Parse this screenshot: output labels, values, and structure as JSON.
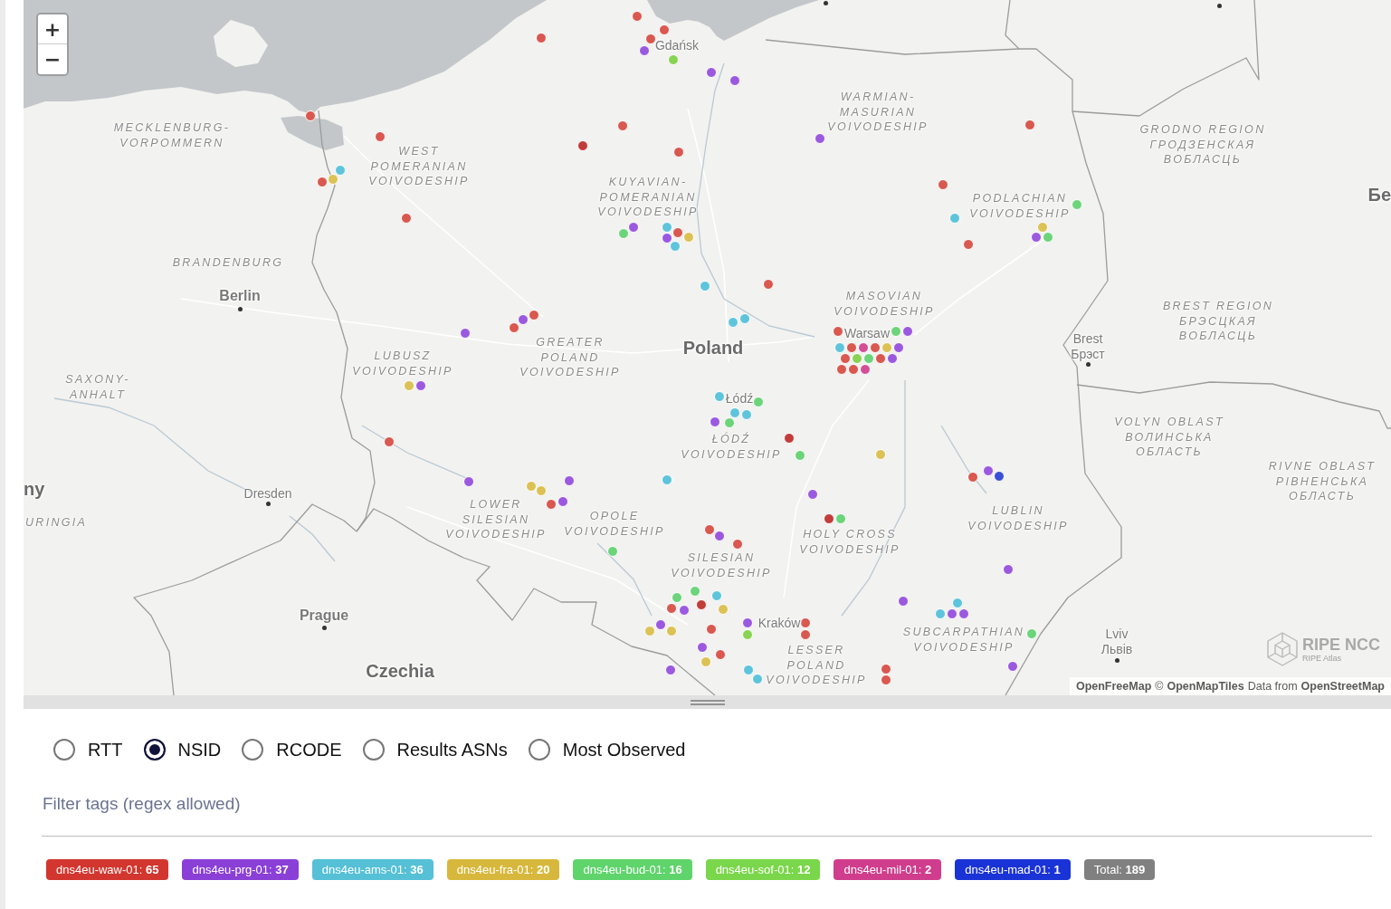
{
  "map": {
    "zoom": [
      {
        "kind": "in",
        "label": "+"
      },
      {
        "kind": "out",
        "label": "−"
      }
    ],
    "labels": [
      {
        "kind": "region",
        "lines": [
          "MECKLENBURG-",
          "VORPOMMERN"
        ]
      },
      {
        "kind": "town",
        "lines": [
          "Gdańsk"
        ]
      },
      {
        "kind": "region",
        "lines": [
          "WARMIAN-",
          "MASURIAN",
          "VOIVODESHIP"
        ]
      },
      {
        "kind": "region",
        "lines": [
          "WEST",
          "POMERANIAN",
          "VOIVODESHIP"
        ]
      },
      {
        "kind": "region",
        "lines": [
          "GRODNO REGION",
          "ГРОДЗЕНСКАЯ",
          "ВОБЛАСЦЬ"
        ]
      },
      {
        "kind": "region",
        "lines": [
          "KUYAVIAN-",
          "POMERANIAN",
          "VOIVODESHIP"
        ]
      },
      {
        "kind": "region",
        "lines": [
          "PODLACHIAN",
          "VOIVODESHIP"
        ]
      },
      {
        "kind": "country",
        "lines": [
          "Бе"
        ]
      },
      {
        "kind": "region",
        "lines": [
          "BRANDENBURG"
        ]
      },
      {
        "kind": "city",
        "lines": [
          "Berlin"
        ]
      },
      {
        "kind": "region",
        "lines": [
          "MASOVIAN",
          "VOIVODESHIP"
        ]
      },
      {
        "kind": "region",
        "lines": [
          "LUBUSZ",
          "VOIVODESHIP"
        ]
      },
      {
        "kind": "region",
        "lines": [
          "GREATER",
          "POLAND",
          "VOIVODESHIP"
        ]
      },
      {
        "kind": "country",
        "lines": [
          "Poland"
        ]
      },
      {
        "kind": "town",
        "lines": [
          "Warsaw"
        ]
      },
      {
        "kind": "town",
        "lines": [
          "Brest",
          "Брэст"
        ]
      },
      {
        "kind": "region",
        "lines": [
          "BREST REGION",
          "БРЭСЦКАЯ",
          "ВОБЛАСЦЬ"
        ]
      },
      {
        "kind": "region",
        "lines": [
          "SAXONY-",
          "ANHALT"
        ]
      },
      {
        "kind": "town",
        "lines": [
          "Łódź"
        ]
      },
      {
        "kind": "region",
        "lines": [
          "ŁÓDŹ",
          "VOIVODESHIP"
        ]
      },
      {
        "kind": "region",
        "lines": [
          "VOLYN OBLAST",
          "ВОЛИНСЬКА",
          "ОБЛАСТЬ"
        ]
      },
      {
        "kind": "country",
        "lines": [
          "ny"
        ]
      },
      {
        "kind": "town",
        "lines": [
          "Dresden"
        ]
      },
      {
        "kind": "region",
        "lines": [
          "RIVNE OBLAST",
          "РІВНЕНСЬКА",
          "ОБЛАСТЬ"
        ]
      },
      {
        "kind": "region",
        "lines": [
          "URINGIA"
        ]
      },
      {
        "kind": "region",
        "lines": [
          "LOWER",
          "SILESIAN",
          "VOIVODESHIP"
        ]
      },
      {
        "kind": "region",
        "lines": [
          "OPOLE",
          "VOIVODESHIP"
        ]
      },
      {
        "kind": "region",
        "lines": [
          "LUBLIN",
          "VOIVODESHIP"
        ]
      },
      {
        "kind": "region",
        "lines": [
          "HOLY CROSS",
          "VOIVODESHIP"
        ]
      },
      {
        "kind": "region",
        "lines": [
          "SILESIAN",
          "VOIVODESHIP"
        ]
      },
      {
        "kind": "city",
        "lines": [
          "Prague"
        ]
      },
      {
        "kind": "town",
        "lines": [
          "Kraków"
        ]
      },
      {
        "kind": "region",
        "lines": [
          "SUBCARPATHIAN",
          "VOIVODESHIP"
        ]
      },
      {
        "kind": "town",
        "lines": [
          "Lviv",
          "Львів"
        ]
      },
      {
        "kind": "country",
        "lines": [
          "Czechia"
        ]
      },
      {
        "kind": "region",
        "lines": [
          "LESSER",
          "POLAND",
          "VOIVODESHIP"
        ]
      }
    ],
    "markers": [
      {
        "color": "#d9584f"
      },
      {
        "color": "#d9584f"
      },
      {
        "color": "#d9584f"
      },
      {
        "color": "#d9584f"
      },
      {
        "color": "#9b59df"
      },
      {
        "color": "#88d455"
      },
      {
        "color": "#9b59df"
      },
      {
        "color": "#9b59df"
      },
      {
        "color": "#d9584f"
      },
      {
        "color": "#d9584f"
      },
      {
        "color": "#c23c3a"
      },
      {
        "color": "#d9584f"
      },
      {
        "color": "#d9584f"
      },
      {
        "color": "#9b59df"
      },
      {
        "color": "#d9584f"
      },
      {
        "color": "#5ec4db"
      },
      {
        "color": "#dcc154"
      },
      {
        "color": "#d9584f"
      },
      {
        "color": "#d9584f"
      },
      {
        "color": "#6cd47a"
      },
      {
        "color": "#5ec4db"
      },
      {
        "color": "#dcc154"
      },
      {
        "color": "#9b59df"
      },
      {
        "color": "#6cd47a"
      },
      {
        "color": "#d9584f"
      },
      {
        "color": "#d9584f"
      },
      {
        "color": "#9b59df"
      },
      {
        "color": "#6cd47a"
      },
      {
        "color": "#5ec4db"
      },
      {
        "color": "#5ec4db"
      },
      {
        "color": "#d9584f"
      },
      {
        "color": "#dcc154"
      },
      {
        "color": "#9b59df"
      },
      {
        "color": "#5ec4db"
      },
      {
        "color": "#d9584f"
      },
      {
        "color": "#5ec4db"
      },
      {
        "color": "#5ec4db"
      },
      {
        "color": "#d9584f"
      },
      {
        "color": "#9b59df"
      },
      {
        "color": "#d9584f"
      },
      {
        "color": "#9b59df"
      },
      {
        "color": "#9b59df"
      },
      {
        "color": "#d9584f"
      },
      {
        "color": "#9b59df"
      },
      {
        "color": "#6cd47a"
      },
      {
        "color": "#d9584f"
      },
      {
        "color": "#5ec4db"
      },
      {
        "color": "#d24f98"
      },
      {
        "color": "#d9584f"
      },
      {
        "color": "#dcc154"
      },
      {
        "color": "#88d455"
      },
      {
        "color": "#6cd47a"
      },
      {
        "color": "#d9584f"
      },
      {
        "color": "#9b59df"
      },
      {
        "color": "#d9584f"
      },
      {
        "color": "#d9584f"
      },
      {
        "color": "#d9584f"
      },
      {
        "color": "#d24f98"
      },
      {
        "color": "#dcc154"
      },
      {
        "color": "#9b59df"
      },
      {
        "color": "#d9584f"
      },
      {
        "color": "#5ec4db"
      },
      {
        "color": "#6cd47a"
      },
      {
        "color": "#5ec4db"
      },
      {
        "color": "#5ec4db"
      },
      {
        "color": "#6cd47a"
      },
      {
        "color": "#9b59df"
      },
      {
        "color": "#c23c3a"
      },
      {
        "color": "#6cd47a"
      },
      {
        "color": "#dcc154"
      },
      {
        "color": "#d9584f"
      },
      {
        "color": "#9b59df"
      },
      {
        "color": "#3b4fd6"
      },
      {
        "color": "#9b59df"
      },
      {
        "color": "#5ec4db"
      },
      {
        "color": "#9b59df"
      },
      {
        "color": "#9b59df"
      },
      {
        "color": "#dcc154"
      },
      {
        "color": "#dcc154"
      },
      {
        "color": "#d9584f"
      },
      {
        "color": "#9b59df"
      },
      {
        "color": "#c23c3a"
      },
      {
        "color": "#6cd47a"
      },
      {
        "color": "#d9584f"
      },
      {
        "color": "#9b59df"
      },
      {
        "color": "#d9584f"
      },
      {
        "color": "#6cd47a"
      },
      {
        "color": "#9b59df"
      },
      {
        "color": "#9b59df"
      },
      {
        "color": "#6cd47a"
      },
      {
        "color": "#6cd47a"
      },
      {
        "color": "#5ec4db"
      },
      {
        "color": "#d9584f"
      },
      {
        "color": "#9b59df"
      },
      {
        "color": "#c23c3a"
      },
      {
        "color": "#dcc154"
      },
      {
        "color": "#9b59df"
      },
      {
        "color": "#dcc154"
      },
      {
        "color": "#dcc154"
      },
      {
        "color": "#d9584f"
      },
      {
        "color": "#9b59df"
      },
      {
        "color": "#d9584f"
      },
      {
        "color": "#d9584f"
      },
      {
        "color": "#88d455"
      },
      {
        "color": "#9b59df"
      },
      {
        "color": "#d9584f"
      },
      {
        "color": "#dcc154"
      },
      {
        "color": "#9b59df"
      },
      {
        "color": "#5ec4db"
      },
      {
        "color": "#5ec4db"
      },
      {
        "color": "#d9584f"
      },
      {
        "color": "#d9584f"
      },
      {
        "color": "#9b59df"
      },
      {
        "color": "#5ec4db"
      },
      {
        "color": "#9b59df"
      },
      {
        "color": "#5ec4db"
      },
      {
        "color": "#6cd47a"
      },
      {
        "color": "#9b59df"
      }
    ],
    "logo": {
      "name": "RIPE NCC",
      "subtitle": "RIPE Atlas"
    },
    "attribution": [
      {
        "kind": "link",
        "text": "OpenFreeMap"
      },
      {
        "kind": "text",
        "text": "©"
      },
      {
        "kind": "link",
        "text": "OpenMapTiles"
      },
      {
        "kind": "text",
        "text": "Data from"
      },
      {
        "kind": "link",
        "text": "OpenStreetMap"
      }
    ]
  },
  "display_modes": [
    {
      "label": "RTT",
      "selected": false
    },
    {
      "label": "NSID",
      "selected": true
    },
    {
      "label": "RCODE",
      "selected": false
    },
    {
      "label": "Results ASNs",
      "selected": false
    },
    {
      "label": "Most Observed",
      "selected": false
    }
  ],
  "filter": {
    "placeholder": "Filter tags (regex allowed)"
  },
  "tags": [
    {
      "label": "dns4eu-waw-01:",
      "count": "65",
      "color": "#d2362e"
    },
    {
      "label": "dns4eu-prg-01:",
      "count": "37",
      "color": "#8a3fd6"
    },
    {
      "label": "dns4eu-ams-01:",
      "count": "36",
      "color": "#55c0d6"
    },
    {
      "label": "dns4eu-fra-01:",
      "count": "20",
      "color": "#d7b83c"
    },
    {
      "label": "dns4eu-bud-01:",
      "count": "16",
      "color": "#5ed46b"
    },
    {
      "label": "dns4eu-sof-01:",
      "count": "12",
      "color": "#7ad64a"
    },
    {
      "label": "dns4eu-mil-01:",
      "count": "2",
      "color": "#cf3d8c"
    },
    {
      "label": "dns4eu-mad-01:",
      "count": "1",
      "color": "#1a33d6"
    },
    {
      "label": "Total:",
      "count": "189",
      "color": "#808080"
    }
  ]
}
